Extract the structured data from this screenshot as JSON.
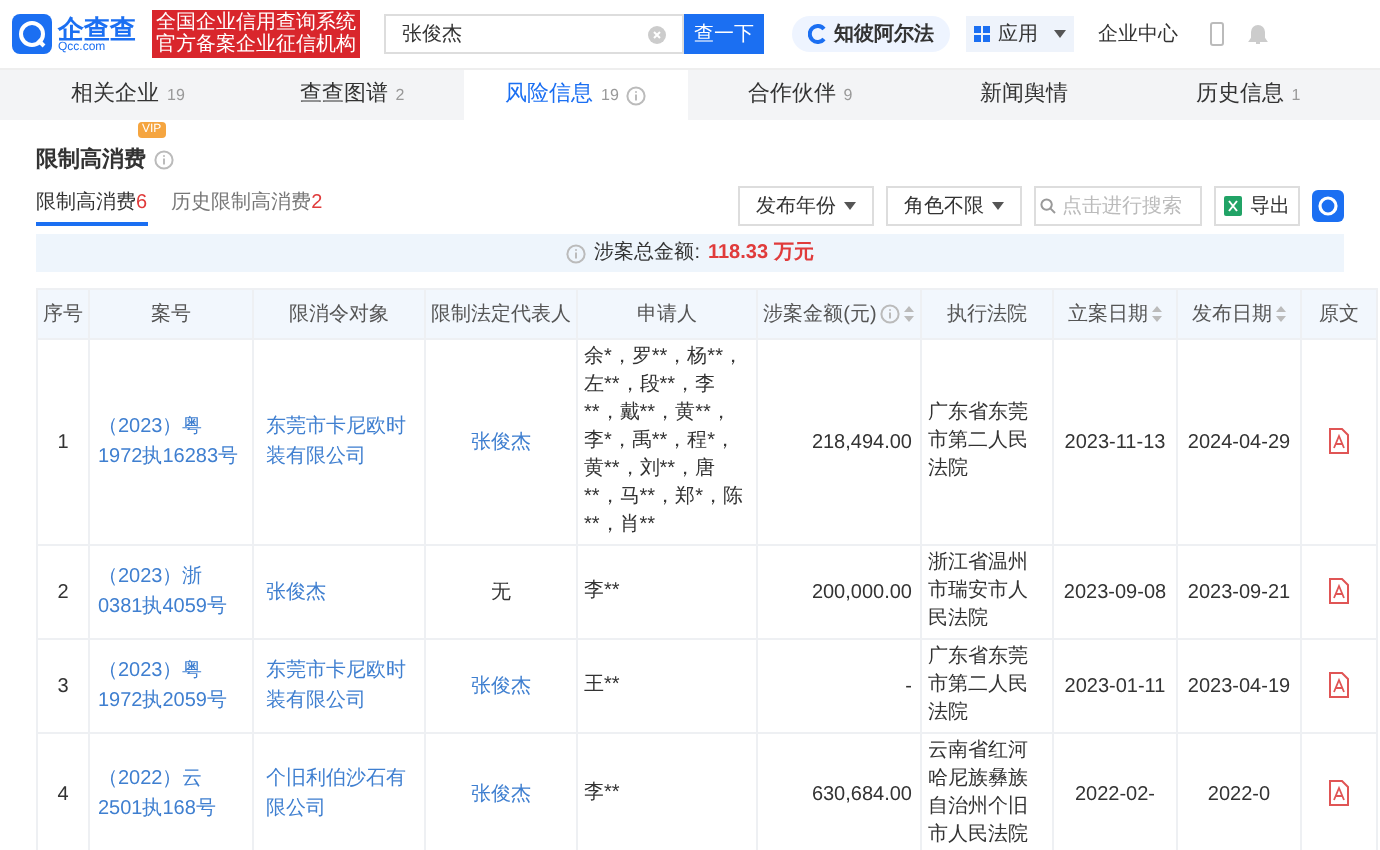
{
  "header": {
    "logo": {
      "name": "企查查",
      "domain": "Qcc.com"
    },
    "badge": [
      "全国企业信用查询系统",
      "官方备案企业征信机构"
    ],
    "search": {
      "value": "张俊杰"
    },
    "search_button": "查一下",
    "alpha": "知彼阿尔法",
    "apps": "应用",
    "enterprise_center": "企业中心"
  },
  "tabs": [
    {
      "label": "相关企业",
      "count": "19",
      "selected": false
    },
    {
      "label": "查查图谱",
      "count": "2",
      "selected": false
    },
    {
      "label": "风险信息",
      "count": "19",
      "selected": true
    },
    {
      "label": "合作伙伴",
      "count": "9",
      "selected": false
    },
    {
      "label": "新闻舆情",
      "selected": false
    },
    {
      "label": "历史信息",
      "count": "1",
      "selected": false
    }
  ],
  "section": {
    "title": "限制高消费",
    "vip": "VIP",
    "subtabs": [
      {
        "label": "限制高消费",
        "count": "6",
        "selected": true
      },
      {
        "label": "历史限制高消费",
        "count": "2",
        "selected": false
      }
    ],
    "filters": [
      "发布年份",
      "角色不限"
    ],
    "search_placeholder": "点击进行搜索",
    "export": "导出"
  },
  "summary": {
    "label": "涉案总金额:",
    "amount": "118.33 万元"
  },
  "table": {
    "columns": [
      {
        "label": "序号",
        "sortable": false,
        "info": false
      },
      {
        "label": "案号",
        "sortable": false,
        "info": false
      },
      {
        "label": "限消令对象",
        "sortable": false,
        "info": false
      },
      {
        "label": "限制法定代表人",
        "sortable": false,
        "info": false
      },
      {
        "label": "申请人",
        "sortable": false,
        "info": false
      },
      {
        "label": "涉案金额(元)",
        "sortable": true,
        "info": true
      },
      {
        "label": "执行法院",
        "sortable": false,
        "info": false
      },
      {
        "label": "立案日期",
        "sortable": true,
        "info": false
      },
      {
        "label": "发布日期",
        "sortable": true,
        "info": false
      },
      {
        "label": "原文",
        "sortable": false,
        "info": false
      }
    ],
    "rows": [
      {
        "index": "1",
        "case_no": "（2023）粤1972执16283号",
        "target": "东莞市卡尼欧时装有限公司",
        "legal_rep": "张俊杰",
        "legal_rep_link": true,
        "applicants": "余*，罗**，杨**，左**，段**，李**，戴**，黄**，李*，禹**，程*，黄**，刘**，唐**，马**，郑*，陈**，肖**",
        "amount": "218,494.00",
        "court": "广东省东莞市第二人民法院",
        "filed": "2023-11-13",
        "published": "2024-04-29"
      },
      {
        "index": "2",
        "case_no": "（2023）浙0381执4059号",
        "target": "张俊杰",
        "legal_rep": "无",
        "legal_rep_link": false,
        "applicants": "李**",
        "amount": "200,000.00",
        "court": "浙江省温州市瑞安市人民法院",
        "filed": "2023-09-08",
        "published": "2023-09-21"
      },
      {
        "index": "3",
        "case_no": "（2023）粤1972执2059号",
        "target": "东莞市卡尼欧时装有限公司",
        "legal_rep": "张俊杰",
        "legal_rep_link": true,
        "applicants": "王**",
        "amount": "-",
        "court": "广东省东莞市第二人民法院",
        "filed": "2023-01-11",
        "published": "2023-04-19"
      },
      {
        "index": "4",
        "case_no": "（2022）云2501执168号",
        "target": "个旧利伯沙石有限公司",
        "legal_rep": "张俊杰",
        "legal_rep_link": true,
        "applicants": "李**",
        "amount": "630,684.00",
        "court": "云南省红河哈尼族彝族自治州个旧市人民法院",
        "filed": "2022-02-",
        "published": "2022-0"
      }
    ]
  }
}
